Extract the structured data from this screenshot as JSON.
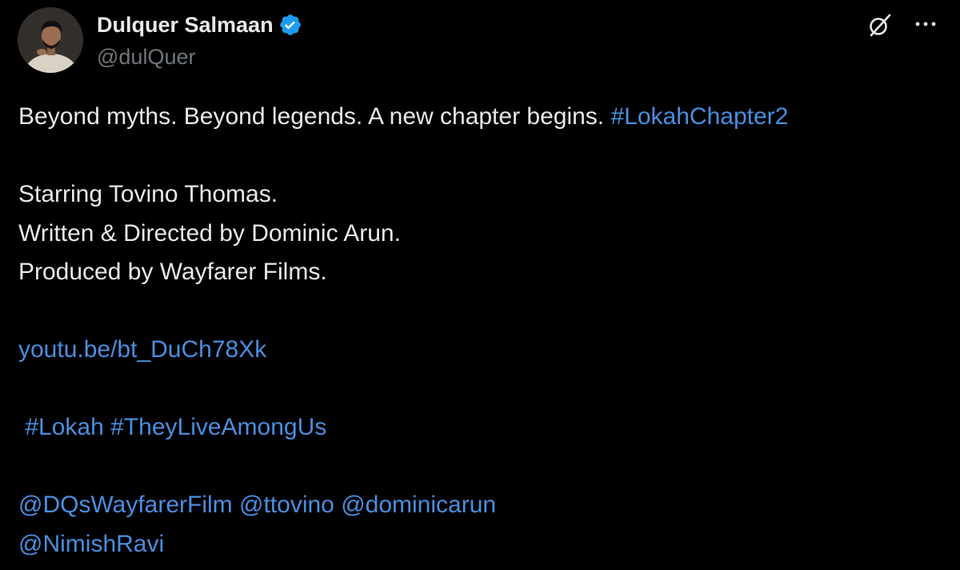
{
  "author": {
    "display_name": "Dulquer Salmaan",
    "handle": "@dulQuer",
    "verified": true
  },
  "tweet": {
    "line1_text": "Beyond myths. Beyond legends. A new chapter begins. ",
    "line1_hashtag": "#LokahChapter2",
    "line3": "Starring Tovino Thomas.",
    "line4": "Written & Directed by Dominic Arun.",
    "line5": "Produced by Wayfarer Films.",
    "link": "youtu.be/bt_DuCh78Xk",
    "hashtag_lokah": "#Lokah",
    "hashtag_theyliveamongus": "#TheyLiveAmongUs",
    "mention_wayfarer": "@DQsWayfarerFilm",
    "mention_tovino": "@ttovino",
    "mention_dominic": "@dominicarun",
    "mention_nimish": "@NimishRavi"
  },
  "icons": {
    "verified": "verified-badge-icon",
    "grok": "grok-icon",
    "more": "more-options-icon"
  },
  "colors": {
    "background": "#000000",
    "text": "#e7e9ea",
    "secondary_text": "#71767b",
    "link": "#4a8ee0",
    "verified": "#1d9bf0"
  }
}
